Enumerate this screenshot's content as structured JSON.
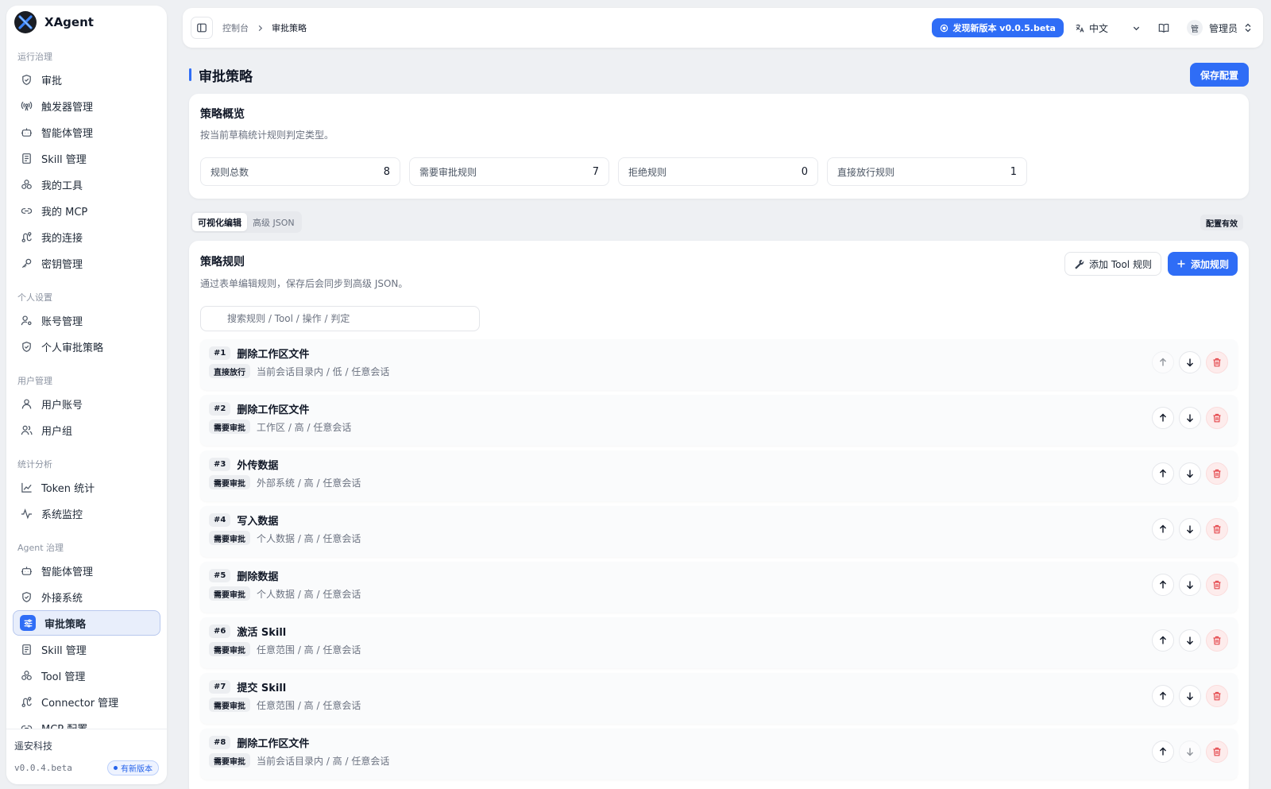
{
  "app": {
    "name": "XAgent"
  },
  "sidebar": {
    "groups": [
      {
        "title": "运行治理",
        "items": [
          {
            "label": "审批",
            "icon": "shield-icon"
          },
          {
            "label": "触发器管理",
            "icon": "broadcast-icon"
          },
          {
            "label": "智能体管理",
            "icon": "bot-icon"
          },
          {
            "label": "Skill 管理",
            "icon": "book-icon"
          },
          {
            "label": "我的工具",
            "icon": "boxes-icon"
          },
          {
            "label": "我的 MCP",
            "icon": "link-icon"
          },
          {
            "label": "我的连接",
            "icon": "route-icon"
          },
          {
            "label": "密钥管理",
            "icon": "key-icon"
          }
        ]
      },
      {
        "title": "个人设置",
        "items": [
          {
            "label": "账号管理",
            "icon": "user-cog-icon"
          },
          {
            "label": "个人审批策略",
            "icon": "shield-icon"
          }
        ]
      },
      {
        "title": "用户管理",
        "items": [
          {
            "label": "用户账号",
            "icon": "user-icon"
          },
          {
            "label": "用户组",
            "icon": "users-icon"
          }
        ]
      },
      {
        "title": "统计分析",
        "items": [
          {
            "label": "Token 统计",
            "icon": "line-chart-icon"
          },
          {
            "label": "系统监控",
            "icon": "activity-icon"
          }
        ]
      },
      {
        "title": "Agent 治理",
        "items": [
          {
            "label": "智能体管理",
            "icon": "bot-icon"
          },
          {
            "label": "外接系统",
            "icon": "shield-icon"
          },
          {
            "label": "审批策略",
            "icon": "sliders-icon",
            "active": true
          },
          {
            "label": "Skill 管理",
            "icon": "book-icon"
          },
          {
            "label": "Tool 管理",
            "icon": "boxes-icon"
          },
          {
            "label": "Connector 管理",
            "icon": "route-icon"
          },
          {
            "label": "MCP 配置",
            "icon": "link-icon"
          }
        ]
      }
    ],
    "footer": {
      "company": "遥安科技",
      "version": "v0.0.4.beta",
      "badge": "有新版本"
    }
  },
  "topbar": {
    "breadcrumb": [
      "控制台",
      "审批策略"
    ],
    "new_version": "发现新版本 v0.0.5.beta",
    "language": "中文",
    "user_avatar": "管",
    "user_name": "管理员"
  },
  "page": {
    "title": "审批策略",
    "save_label": "保存配置"
  },
  "overview": {
    "title": "策略概览",
    "subtitle": "按当前草稿统计规则判定类型。",
    "stats": [
      {
        "label": "规则总数",
        "value": "8"
      },
      {
        "label": "需要审批规则",
        "value": "7"
      },
      {
        "label": "拒绝规则",
        "value": "0"
      },
      {
        "label": "直接放行规则",
        "value": "1"
      }
    ]
  },
  "tabs": [
    "可视化编辑",
    "高级 JSON"
  ],
  "config_status": "配置有效",
  "rules": {
    "title": "策略规则",
    "subtitle": "通过表单编辑规则，保存后会同步到高级 JSON。",
    "add_tool_label": "添加 Tool 规则",
    "add_rule_label": "添加规则",
    "search_placeholder": "搜索规则 / Tool / 操作 / 判定",
    "items": [
      {
        "index": "#1",
        "name": "删除工作区文件",
        "tag": "直接放行",
        "desc": "当前会话目录内 / 低 / 任意会话"
      },
      {
        "index": "#2",
        "name": "删除工作区文件",
        "tag": "需要审批",
        "desc": "工作区 / 高 / 任意会话"
      },
      {
        "index": "#3",
        "name": "外传数据",
        "tag": "需要审批",
        "desc": "外部系统 / 高 / 任意会话"
      },
      {
        "index": "#4",
        "name": "写入数据",
        "tag": "需要审批",
        "desc": "个人数据 / 高 / 任意会话"
      },
      {
        "index": "#5",
        "name": "删除数据",
        "tag": "需要审批",
        "desc": "个人数据 / 高 / 任意会话"
      },
      {
        "index": "#6",
        "name": "激活 Skill",
        "tag": "需要审批",
        "desc": "任意范围 / 高 / 任意会话"
      },
      {
        "index": "#7",
        "name": "提交 Skill",
        "tag": "需要审批",
        "desc": "任意范围 / 高 / 任意会话"
      },
      {
        "index": "#8",
        "name": "删除工作区文件",
        "tag": "需要审批",
        "desc": "当前会话目录内 / 高 / 任意会话"
      }
    ]
  },
  "colors": {
    "accent": "#2f6df6",
    "danger": "#e5484d"
  }
}
